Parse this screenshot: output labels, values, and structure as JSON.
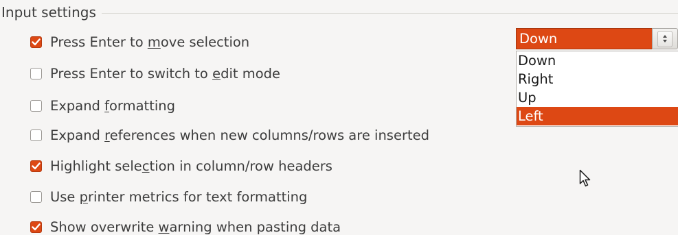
{
  "section": {
    "title": "Input settings"
  },
  "options": [
    {
      "pre": "Press Enter to ",
      "key": "m",
      "post": "ove selection",
      "checked": true
    },
    {
      "pre": "Press Enter to switch to ",
      "key": "e",
      "post": "dit mode",
      "checked": false
    },
    {
      "pre": "Expand ",
      "key": "f",
      "post": "ormatting",
      "checked": false
    },
    {
      "pre": "Expand ",
      "key": "r",
      "post": "eferences when new columns/rows are inserted",
      "checked": false
    },
    {
      "pre": "Highlight sele",
      "key": "c",
      "post": "tion in column/row headers",
      "checked": true
    },
    {
      "pre": "Use ",
      "key": "p",
      "post": "rinter metrics for text formatting",
      "checked": false
    },
    {
      "pre": "Show overwrite ",
      "key": "w",
      "post": "arning when pasting data",
      "checked": true
    }
  ],
  "move_direction": {
    "current_value": "Down",
    "items": [
      "Down",
      "Right",
      "Up",
      "Left"
    ],
    "highlighted": "Left"
  },
  "colors": {
    "accent": "#dd4814",
    "text": "#3c3c3c",
    "background": "#f6f5f4"
  },
  "icons": {
    "spin": "spin-button-icon",
    "check": "check-icon",
    "cursor": "mouse-pointer-icon"
  }
}
